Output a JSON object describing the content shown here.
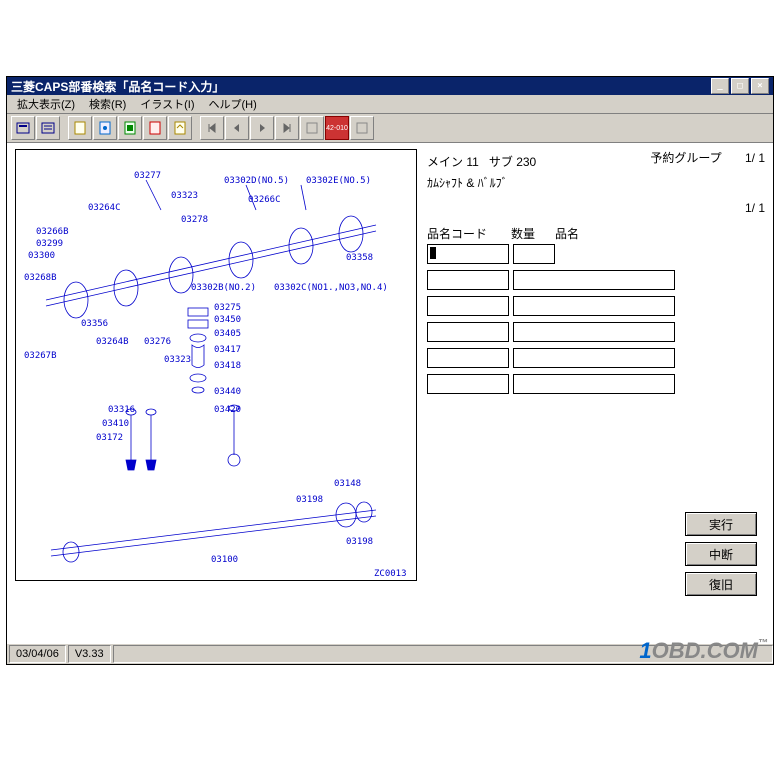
{
  "window": {
    "title": "三菱CAPS部番検索「品名コード入力」"
  },
  "menu": {
    "items": [
      "拡大表示(Z)",
      "検索(R)",
      "イラスト(I)",
      "ヘルプ(H)"
    ]
  },
  "info": {
    "main_label": "メイン",
    "main_val": "11",
    "sub_label": "サブ",
    "sub_val": "230",
    "desc": "ｶﾑｼｬﾌﾄ & ﾊﾞﾙﾌﾞ",
    "yoyaku": "予約グループ",
    "page1": "1/ 1",
    "page2": "1/ 1"
  },
  "table": {
    "headers": [
      "品名コード",
      "数量",
      "品名"
    ],
    "rows": 6
  },
  "buttons": {
    "exec": "実行",
    "abort": "中断",
    "restore": "復旧"
  },
  "status": {
    "date": "03/04/06",
    "ver": "V3.33"
  },
  "diagram": {
    "code": "ZC0013",
    "parts": [
      "03277",
      "03302D(NO.5)",
      "03302E(NO.5)",
      "03323",
      "03266C",
      "03264C",
      "03278",
      "03266B",
      "03299",
      "03300",
      "03358",
      "03268B",
      "03302B(NO.2)",
      "03302C(NO1.,NO3,NO.4)",
      "03275",
      "03356",
      "03264B",
      "03276",
      "03450",
      "03405",
      "03267B",
      "03323",
      "03417",
      "03418",
      "03440",
      "03316",
      "03420",
      "03410",
      "03172",
      "03148",
      "03198",
      "03198",
      "03100"
    ]
  },
  "branding": "1OBD.COM"
}
